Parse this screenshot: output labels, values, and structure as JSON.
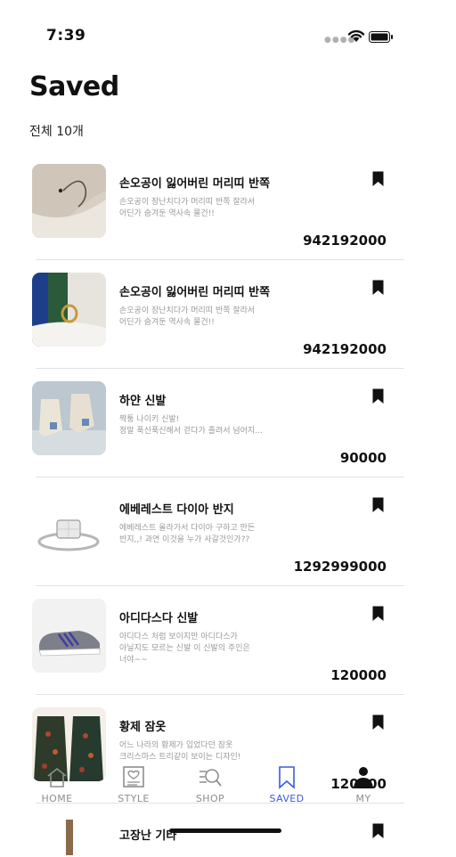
{
  "status": {
    "time": "7:39"
  },
  "page": {
    "title": "Saved",
    "count_label": "전체 10개"
  },
  "items": [
    {
      "title": "손오공이 잃어버린 머리띠 반쪽",
      "desc": "손오공이 장난치다가 머리띠 반쪽 잘라서\n어딘가 숨겨둔 역사속 물건!!",
      "price": "942192000",
      "image": "ring-hoop"
    },
    {
      "title": "손오공이 잃어버린 머리띠 반쪽",
      "desc": "손오공이 장난치다가 머리띠 반쪽 잘라서\n어딘가 숨겨둔 역사속 물건!!",
      "price": "942192000",
      "image": "gold-ring"
    },
    {
      "title": "하얀 신발",
      "desc": "짝퉁 나이키 신발!\n정말 푹신푹신해서 걷다가 졸려서 넘어지...",
      "price": "90000",
      "image": "white-sneakers"
    },
    {
      "title": "에베레스트 다이아 반지",
      "desc": "에베레스트 올라가서 다이아 구하고 만든\n반지,,! 과연 이것을 누가 사갈것인가??",
      "price": "1292999000",
      "image": "diamond-ring"
    },
    {
      "title": "아디다스다 신발",
      "desc": "아디다스 처럼 보이지만 아디다스가\n아닐지도 모르는 신발 이 신발의 주인은\n너야~~",
      "price": "120000",
      "image": "running-shoe"
    },
    {
      "title": "황제 잠옷",
      "desc": "어느 나라의 황제가 입었다던 잠옷\n크리스마스 트리같이 보이는 디자인!",
      "price": "120000",
      "image": "robes"
    },
    {
      "title": "고장난 기타",
      "desc": "",
      "price": "",
      "image": "guitar"
    }
  ],
  "tabs": [
    {
      "label": "HOME",
      "icon": "home-icon",
      "active": false
    },
    {
      "label": "STYLE",
      "icon": "style-icon",
      "active": false
    },
    {
      "label": "SHOP",
      "icon": "shop-search-icon",
      "active": false
    },
    {
      "label": "SAVED",
      "icon": "bookmark-outline-icon",
      "active": true
    },
    {
      "label": "MY",
      "icon": "person-icon",
      "active": false
    }
  ],
  "colors": {
    "accent": "#3b5bdb",
    "text": "#111111",
    "muted": "#9a9a9a"
  }
}
